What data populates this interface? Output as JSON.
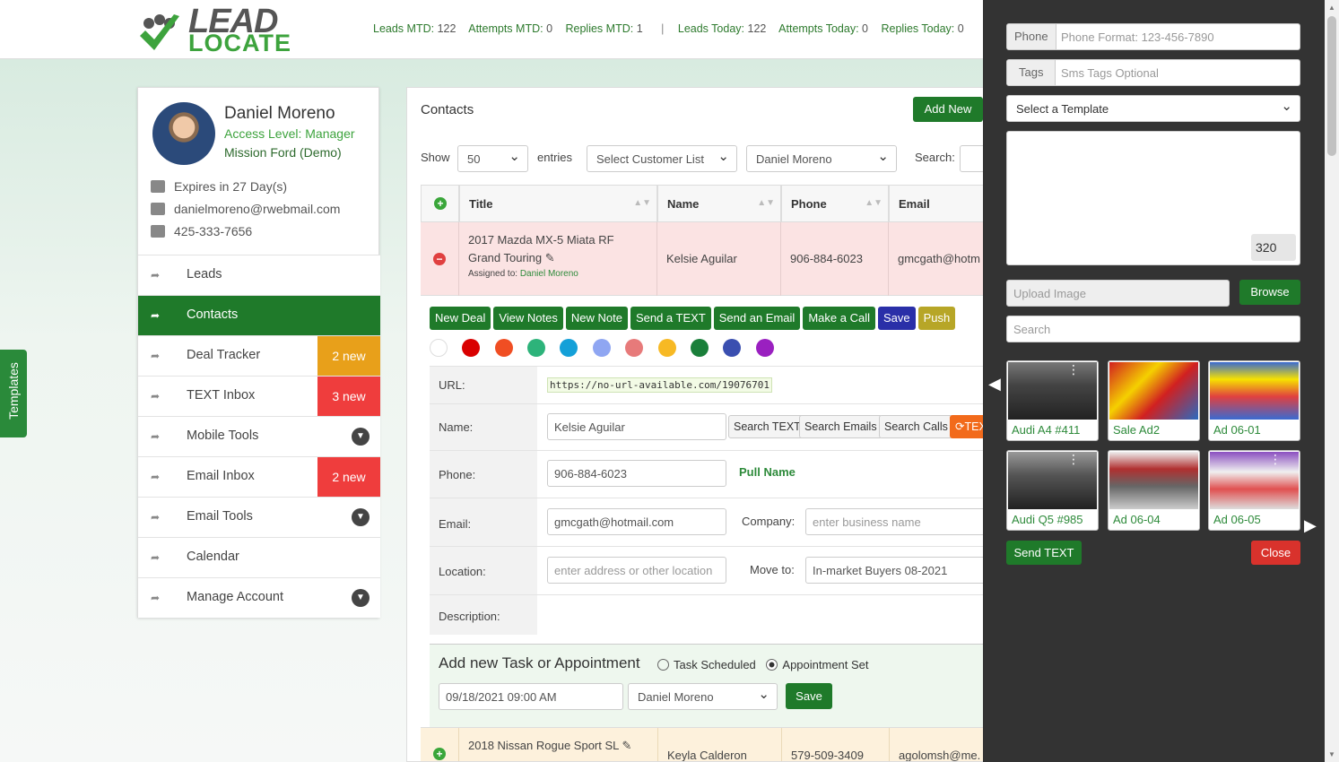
{
  "header": {
    "logo_line1": "LEAD",
    "logo_line2": "LOCATE",
    "stats": [
      {
        "label": "Leads MTD:",
        "value": "122"
      },
      {
        "label": "Attempts MTD:",
        "value": "0"
      },
      {
        "label": "Replies MTD:",
        "value": "1"
      },
      {
        "label": "Leads Today:",
        "value": "122"
      },
      {
        "label": "Attempts Today:",
        "value": "0"
      },
      {
        "label": "Replies Today:",
        "value": "0"
      }
    ],
    "separator": "|"
  },
  "templates_tab": "Templates",
  "profile": {
    "name": "Daniel Moreno",
    "access_level": "Access Level: Manager",
    "dealership": "Mission Ford (Demo)",
    "expires": "Expires in 27 Day(s)",
    "email": "danielmoreno@rwebmail.com",
    "phone": "425-333-7656"
  },
  "menu": [
    {
      "label": "Leads",
      "badge": "",
      "dropdown": false,
      "active": false
    },
    {
      "label": "Contacts",
      "badge": "",
      "dropdown": false,
      "active": true
    },
    {
      "label": "Deal Tracker",
      "badge": "2 new",
      "badge_color": "#e8a01a",
      "dropdown": false,
      "active": false
    },
    {
      "label": "TEXT Inbox",
      "badge": "3 new",
      "badge_color": "#ef3d3d",
      "dropdown": false,
      "active": false
    },
    {
      "label": "Mobile Tools",
      "badge": "",
      "dropdown": true,
      "active": false
    },
    {
      "label": "Email Inbox",
      "badge": "2 new",
      "badge_color": "#ef3d3d",
      "dropdown": false,
      "active": false
    },
    {
      "label": "Email Tools",
      "badge": "",
      "dropdown": true,
      "active": false
    },
    {
      "label": "Calendar",
      "badge": "",
      "dropdown": false,
      "active": false
    },
    {
      "label": "Manage Account",
      "badge": "",
      "dropdown": true,
      "active": false
    }
  ],
  "contacts": {
    "title": "Contacts",
    "add_new": "Add New",
    "show_label": "Show",
    "entries_value": "50",
    "entries_label": "entries",
    "customer_list": "Select Customer List",
    "user_filter": "Daniel Moreno",
    "search_label": "Search:",
    "columns": [
      "Title",
      "Name",
      "Phone",
      "Email"
    ],
    "row1": {
      "title_line1": "2017 Mazda MX-5 Miata RF",
      "title_line2": "Grand Touring",
      "assigned_label": "Assigned to:",
      "assigned_to": "Daniel Moreno",
      "name": "Kelsie Aguilar",
      "phone": "906-884-6023",
      "email": "gmcgath@hotm"
    },
    "actions": [
      "New Deal",
      "View Notes",
      "New Note",
      "Send a TEXT",
      "Send an Email",
      "Make a Call",
      "Save",
      "Push"
    ],
    "color_swatches": [
      "#ffffff",
      "#d90000",
      "#f04e23",
      "#2db37a",
      "#14a0d8",
      "#8fa6f2",
      "#e77a7a",
      "#f7b924",
      "#1a7f3a",
      "#3a4fb0",
      "#9a20c0"
    ],
    "detail": {
      "url_label": "URL:",
      "url_value": "https://no-url-available.com/19076701",
      "name_label": "Name:",
      "name_value": "Kelsie Aguilar",
      "search_text": "Search TEXT",
      "search_emails": "Search Emails",
      "search_calls": "Search Calls",
      "text_button": "TEX",
      "phone_label": "Phone:",
      "phone_value": "906-884-6023",
      "pull_name": "Pull Name",
      "email_label": "Email:",
      "email_value": "gmcgath@hotmail.com",
      "company_label": "Company:",
      "company_placeholder": "enter business name",
      "location_label": "Location:",
      "location_placeholder": "enter address or other location",
      "move_to_label": "Move to:",
      "move_to_value": "In-market Buyers 08-2021",
      "description_label": "Description:"
    },
    "task": {
      "title": "Add new Task or Appointment",
      "option1": "Task Scheduled",
      "option2": "Appointment Set",
      "selected": "Appointment Set",
      "datetime": "09/18/2021 09:00 AM",
      "assignee": "Daniel Moreno",
      "save": "Save"
    },
    "row2": {
      "title": "2018 Nissan Rogue Sport SL",
      "name": "Keyla Calderon",
      "phone": "579-509-3409",
      "email": "agolomsh@me."
    }
  },
  "sms_panel": {
    "phone_addon": "Phone",
    "phone_placeholder": "Phone Format: 123-456-7890",
    "tags_addon": "Tags",
    "tags_placeholder": "Sms Tags Optional",
    "template_select": "Select a Template",
    "char_count": "320",
    "upload_placeholder": "Upload Image",
    "browse": "Browse",
    "search_placeholder": "Search",
    "tiles": [
      "Audi A4 #411",
      "Sale Ad2",
      "Ad 06-01",
      "Audi Q5 #985",
      "Ad 06-04",
      "Ad 06-05"
    ],
    "send_text": "Send TEXT",
    "close": "Close"
  }
}
